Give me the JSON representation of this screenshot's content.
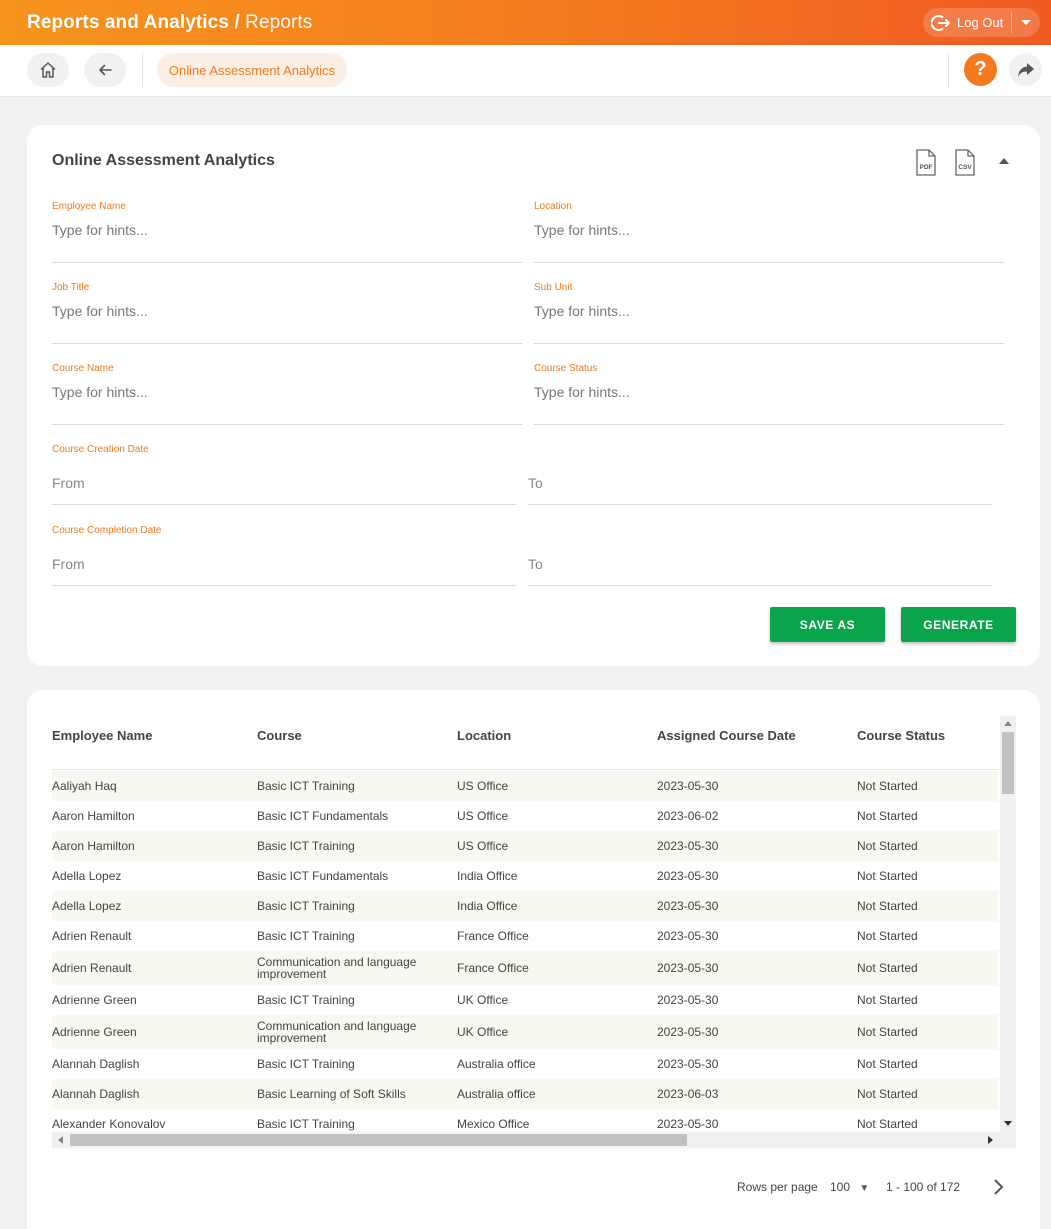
{
  "header": {
    "title": "Reports and Analytics",
    "separator": "/",
    "subtitle": "Reports",
    "logout_label": "Log Out"
  },
  "nav": {
    "breadcrumb": "Online Assessment Analytics",
    "help_label": "?"
  },
  "filters": {
    "title": "Online Assessment Analytics",
    "pdf_label": "PDF",
    "csv_label": "CSV",
    "employee_name": {
      "label": "Employee Name",
      "placeholder": "Type for hints..."
    },
    "location": {
      "label": "Location",
      "placeholder": "Type for hints..."
    },
    "job_title": {
      "label": "Job Title",
      "placeholder": "Type for hints..."
    },
    "sub_unit": {
      "label": "Sub Unit",
      "placeholder": "Type for hints..."
    },
    "course_name": {
      "label": "Course Name",
      "placeholder": "Type for hints..."
    },
    "course_status": {
      "label": "Course Status",
      "placeholder": "Type for hints..."
    },
    "creation_date": {
      "label": "Course Creation Date",
      "from": "From",
      "to": "To"
    },
    "completion_date": {
      "label": "Course Completion Date",
      "from": "From",
      "to": "To"
    },
    "save_as_label": "SAVE AS",
    "generate_label": "GENERATE"
  },
  "table": {
    "columns": [
      "Employee Name",
      "Course",
      "Location",
      "Assigned Course Date",
      "Course Status"
    ],
    "rows": [
      [
        "Aaliyah Haq",
        "Basic ICT Training",
        "US Office",
        "2023-05-30",
        "Not Started"
      ],
      [
        "Aaron Hamilton",
        "Basic ICT Fundamentals",
        "US Office",
        "2023-06-02",
        "Not Started"
      ],
      [
        "Aaron Hamilton",
        "Basic ICT Training",
        "US Office",
        "2023-05-30",
        "Not Started"
      ],
      [
        "Adella Lopez",
        "Basic ICT Fundamentals",
        "India Office",
        "2023-05-30",
        "Not Started"
      ],
      [
        "Adella Lopez",
        "Basic ICT Training",
        "India Office",
        "2023-05-30",
        "Not Started"
      ],
      [
        "Adrien Renault",
        "Basic ICT Training",
        "France Office",
        "2023-05-30",
        "Not Started"
      ],
      [
        "Adrien Renault",
        "Communication and language improvement",
        "France Office",
        "2023-05-30",
        "Not Started"
      ],
      [
        "Adrienne Green",
        "Basic ICT Training",
        "UK Office",
        "2023-05-30",
        "Not Started"
      ],
      [
        "Adrienne Green",
        "Communication and language improvement",
        "UK Office",
        "2023-05-30",
        "Not Started"
      ],
      [
        "Alannah Daglish",
        "Basic ICT Training",
        "Australia office",
        "2023-05-30",
        "Not Started"
      ],
      [
        "Alannah Daglish",
        "Basic Learning of Soft Skills",
        "Australia office",
        "2023-06-03",
        "Not Started"
      ],
      [
        "Alexander Konovalov",
        "Basic ICT Training",
        "Mexico Office",
        "2023-05-30",
        "Not Started"
      ]
    ]
  },
  "pagination": {
    "rows_per_page_label": "Rows per page",
    "rows_per_page_value": "100",
    "range_label": "1 - 100 of 172"
  },
  "colors": {
    "accent": "#f47a20",
    "primary_button": "#0aa54b"
  }
}
